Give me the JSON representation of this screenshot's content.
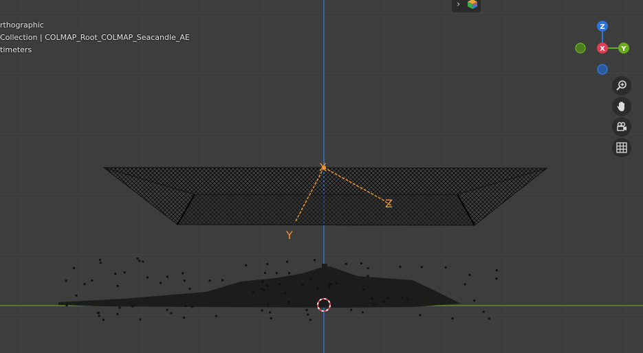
{
  "overlay": {
    "view_mode": "rthographic",
    "collection": "Collection | COLMAP_Root_COLMAP_Seacandle_AE",
    "units": "timeters"
  },
  "gizmo": {
    "z_label": "Z",
    "x_label": "X",
    "y_label": "Y",
    "z_color": "#2c75d8",
    "x_color": "#e23c53",
    "y_color": "#6aab1e"
  },
  "camera_labels": {
    "x": "X",
    "y": "Y",
    "z": "Z"
  },
  "colors": {
    "background": "#3d3d3d",
    "grid": "#474747",
    "z_axis_line": "#2e6fd0",
    "y_axis_line": "#6a9a33",
    "selection_orange": "#f0962e",
    "mesh": "#111111"
  },
  "nav_buttons": [
    "zoom-icon",
    "hand-icon",
    "camera-icon",
    "grid-icon"
  ]
}
